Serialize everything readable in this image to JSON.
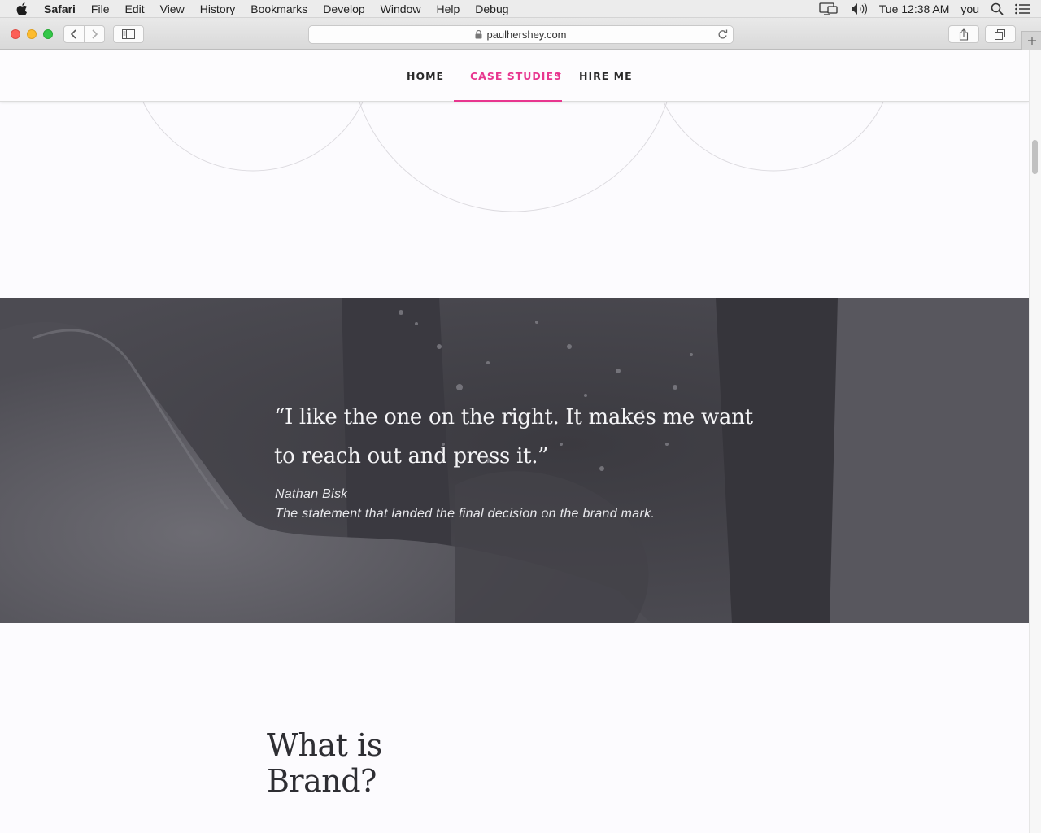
{
  "menubar": {
    "app_name": "Safari",
    "items": [
      "File",
      "Edit",
      "View",
      "History",
      "Bookmarks",
      "Develop",
      "Window",
      "Help",
      "Debug"
    ],
    "clock": "Tue 12:38 AM",
    "user": "you",
    "icons": [
      "apple-icon",
      "airplay-display-icon",
      "volume-icon",
      "spotlight-search-icon",
      "notification-center-icon"
    ]
  },
  "toolbar": {
    "url": "paulhershey.com",
    "icons": [
      "back-icon",
      "forward-icon",
      "sidebar-icon",
      "lock-icon",
      "reload-icon",
      "share-icon",
      "tabs-overview-icon",
      "new-tab-icon"
    ]
  },
  "nav": {
    "home": "HOME",
    "case_studies": "CASE STUDIES",
    "hire_me": "HIRE ME",
    "accent_color": "#e8368f"
  },
  "quote": {
    "text": "“I like the one on the right. It makes me want to reach out and press it.”",
    "author": "Nathan Bisk",
    "note": "The statement that landed the final decision on the brand mark."
  },
  "section": {
    "heading_line1": "What is",
    "heading_line2": "Brand?"
  }
}
